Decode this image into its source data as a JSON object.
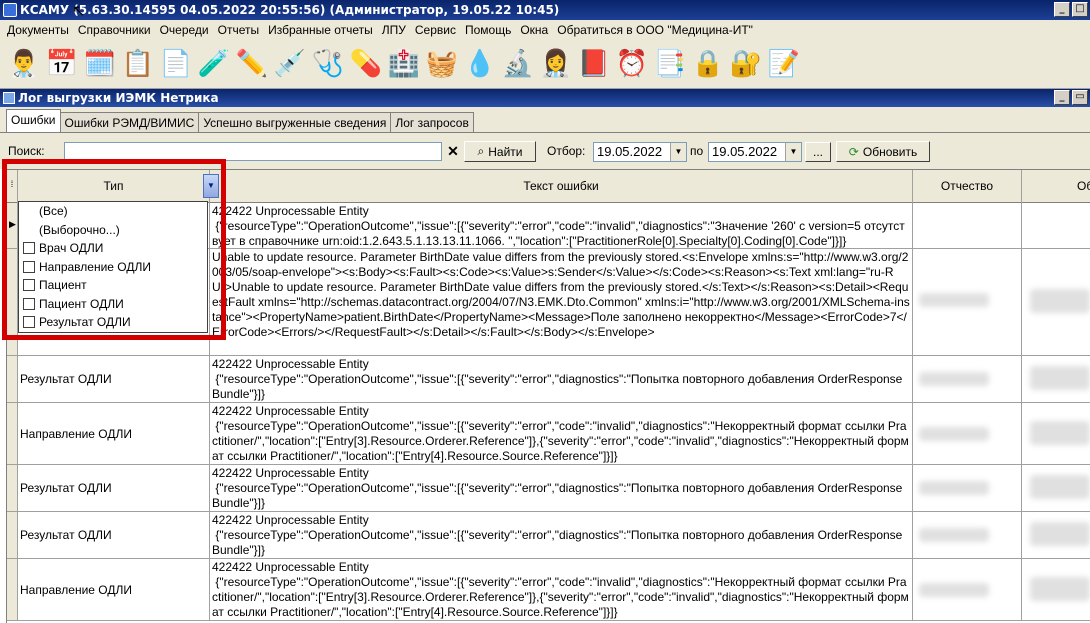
{
  "window": {
    "title": "КСАМУ (5.63.30.14595 04.05.2022 20:55:56) (Администратор, 19.05.22 10:45)"
  },
  "menu": [
    "Документы",
    "Справочники",
    "Очереди",
    "Отчеты",
    "Избранные отчеты",
    "ЛПУ",
    "Сервис",
    "Помощь",
    "Окна",
    "Обратиться в ООО \"Медицина-ИТ\""
  ],
  "toolbar_icons": [
    "👨‍⚕️",
    "📅",
    "🗓️",
    "📋",
    "📄",
    "🧪",
    "✏️",
    "💉",
    "🩺",
    "💊",
    "🏥",
    "🧺",
    "💧",
    "🔬",
    "👩‍⚕️",
    "📕",
    "⏰",
    "📑",
    "🔒",
    "🔐",
    "📝"
  ],
  "child": {
    "title": "Лог выгрузки ИЭМК Нетрика"
  },
  "tabs": [
    "Ошибки",
    "Ошибки РЭМД/ВИМИС",
    "Успешно выгруженные сведения",
    "Лог запросов"
  ],
  "search": {
    "label": "Поиск:",
    "value": "",
    "find": "Найти",
    "filter_label": "Отбор:",
    "date_from": "19.05.2022",
    "to_label": "по",
    "date_to": "19.05.2022",
    "more": "...",
    "refresh": "Обновить"
  },
  "grid": {
    "headers": {
      "type": "Тип",
      "text": "Текст ошибки",
      "otch": "Отчество",
      "last": "Об"
    },
    "rows": [
      {
        "type": "",
        "text": "422422 Unprocessable Entity\n {\"resourceType\":\"OperationOutcome\",\"issue\":[{\"severity\":\"error\",\"code\":\"invalid\",\"diagnostics\":\"Значение '260' с version=5 отсутствует в справочнике urn:oid:1.2.643.5.1.13.13.11.1066. \",\"location\":[\"PractitionerRole[0].Specialty[0].Coding[0].Code\"]}]}"
      },
      {
        "type": "",
        "text": "Unable to update resource. Parameter BirthDate value differs from the previously stored.<s:Envelope xmlns:s=\"http://www.w3.org/2003/05/soap-envelope\"><s:Body><s:Fault><s:Code><s:Value>s:Sender</s:Value></s:Code><s:Reason><s:Text xml:lang=\"ru-RU\">Unable to update resource. Parameter BirthDate value differs from the previously stored.</s:Text></s:Reason><s:Detail><RequestFault xmlns=\"http://schemas.datacontract.org/2004/07/N3.EMK.Dto.Common\" xmlns:i=\"http://www.w3.org/2001/XMLSchema-instance\"><PropertyName>patient.BirthDate</PropertyName><Message>Поле заполнено некорректно</Message><ErrorCode>7</ErrorCode><Errors/></RequestFault></s:Detail></s:Fault></s:Body></s:Envelope>"
      },
      {
        "type": "Результат ОДЛИ",
        "text": "422422 Unprocessable Entity\n {\"resourceType\":\"OperationOutcome\",\"issue\":[{\"severity\":\"error\",\"diagnostics\":\"Попытка повторного добавления OrderResponseBundle\"}]}"
      },
      {
        "type": "Направление ОДЛИ",
        "text": "422422 Unprocessable Entity\n {\"resourceType\":\"OperationOutcome\",\"issue\":[{\"severity\":\"error\",\"code\":\"invalid\",\"diagnostics\":\"Некорректный формат ссылки Practitioner/\",\"location\":[\"Entry[3].Resource.Orderer.Reference\"]},{\"severity\":\"error\",\"code\":\"invalid\",\"diagnostics\":\"Некорректный формат ссылки Practitioner/\",\"location\":[\"Entry[4].Resource.Source.Reference\"]}]}"
      },
      {
        "type": "Результат ОДЛИ",
        "text": "422422 Unprocessable Entity\n {\"resourceType\":\"OperationOutcome\",\"issue\":[{\"severity\":\"error\",\"diagnostics\":\"Попытка повторного добавления OrderResponseBundle\"}]}"
      },
      {
        "type": "Результат ОДЛИ",
        "text": "422422 Unprocessable Entity\n {\"resourceType\":\"OperationOutcome\",\"issue\":[{\"severity\":\"error\",\"diagnostics\":\"Попытка повторного добавления OrderResponseBundle\"}]}"
      },
      {
        "type": "Направление ОДЛИ",
        "text": "422422 Unprocessable Entity\n {\"resourceType\":\"OperationOutcome\",\"issue\":[{\"severity\":\"error\",\"code\":\"invalid\",\"diagnostics\":\"Некорректный формат ссылки Practitioner/\",\"location\":[\"Entry[3].Resource.Orderer.Reference\"]},{\"severity\":\"error\",\"code\":\"invalid\",\"diagnostics\":\"Некорректный формат ссылки Practitioner/\",\"location\":[\"Entry[4].Resource.Source.Reference\"]}]}"
      }
    ]
  },
  "filter_popup": {
    "items": [
      {
        "label": "(Все)",
        "checkbox": false
      },
      {
        "label": "(Выборочно...)",
        "checkbox": false
      },
      {
        "label": "Врач ОДЛИ",
        "checkbox": true
      },
      {
        "label": "Направление ОДЛИ",
        "checkbox": true
      },
      {
        "label": "Пациент",
        "checkbox": true
      },
      {
        "label": "Пациент ОДЛИ",
        "checkbox": true
      },
      {
        "label": "Результат ОДЛИ",
        "checkbox": true
      }
    ]
  }
}
